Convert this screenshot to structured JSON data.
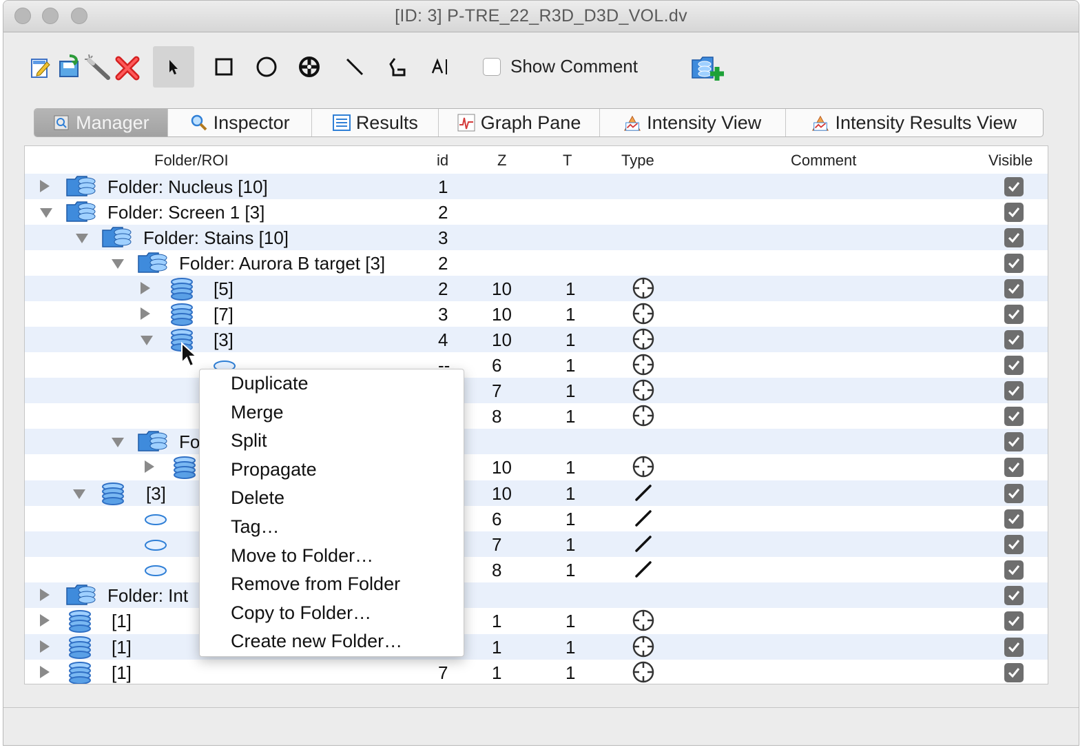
{
  "window": {
    "title": "[ID: 3] P-TRE_22_R3D_D3D_VOL.dv"
  },
  "toolbar": {
    "show_comment_label": "Show Comment",
    "show_comment_checked": false
  },
  "tabs": [
    {
      "label": "Manager",
      "icon": "magnifier-page-icon",
      "selected": true
    },
    {
      "label": "Inspector",
      "icon": "magnifier-icon",
      "selected": false
    },
    {
      "label": "Results",
      "icon": "list-icon",
      "selected": false
    },
    {
      "label": "Graph Pane",
      "icon": "graph-icon",
      "selected": false
    },
    {
      "label": "Intensity View",
      "icon": "intensity-icon",
      "selected": false
    },
    {
      "label": "Intensity Results View",
      "icon": "intensity-icon",
      "selected": false
    }
  ],
  "table": {
    "headers": {
      "folder_roi": "Folder/ROI",
      "id": "id",
      "z": "Z",
      "t": "T",
      "type": "Type",
      "comment": "Comment",
      "visible": "Visible"
    },
    "rows": [
      {
        "label": "Folder: Nucleus [10]",
        "id": "1",
        "z": "",
        "t": "",
        "type": "",
        "disc": "right",
        "icon": "folder"
      },
      {
        "label": "Folder: Screen 1 [3]",
        "id": "2",
        "z": "",
        "t": "",
        "type": "",
        "disc": "down",
        "icon": "folder"
      },
      {
        "label": "Folder: Stains [10]",
        "id": "3",
        "z": "",
        "t": "",
        "type": "",
        "disc": "down",
        "icon": "folder"
      },
      {
        "label": "Folder: Aurora B target [3]",
        "id": "2",
        "z": "",
        "t": "",
        "type": "",
        "disc": "down",
        "icon": "folder"
      },
      {
        "label": "[5]",
        "id": "2",
        "z": "10",
        "t": "1",
        "type": "point",
        "disc": "right",
        "icon": "db"
      },
      {
        "label": "[7]",
        "id": "3",
        "z": "10",
        "t": "1",
        "type": "point",
        "disc": "right",
        "icon": "db"
      },
      {
        "label": "[3]",
        "id": "4",
        "z": "10",
        "t": "1",
        "type": "point",
        "disc": "down",
        "icon": "db"
      },
      {
        "label": "",
        "id": "--",
        "z": "6",
        "t": "1",
        "type": "point",
        "disc": "",
        "icon": "oval"
      },
      {
        "label": "",
        "id": "",
        "z": "7",
        "t": "1",
        "type": "point",
        "disc": "",
        "icon": ""
      },
      {
        "label": "",
        "id": "",
        "z": "8",
        "t": "1",
        "type": "point",
        "disc": "",
        "icon": ""
      },
      {
        "label": "Fo",
        "id": "",
        "z": "",
        "t": "",
        "type": "",
        "disc": "down",
        "icon": "folder"
      },
      {
        "label": "",
        "id": "",
        "z": "10",
        "t": "1",
        "type": "point",
        "disc": "right",
        "icon": "db"
      },
      {
        "label": "[3]",
        "id": "",
        "z": "10",
        "t": "1",
        "type": "line",
        "disc": "down",
        "icon": "db"
      },
      {
        "label": "",
        "id": "",
        "z": "6",
        "t": "1",
        "type": "line",
        "disc": "",
        "icon": "oval"
      },
      {
        "label": "",
        "id": "",
        "z": "7",
        "t": "1",
        "type": "line",
        "disc": "",
        "icon": "oval"
      },
      {
        "label": "",
        "id": "",
        "z": "8",
        "t": "1",
        "type": "line",
        "disc": "",
        "icon": "oval"
      },
      {
        "label": "Folder: Int",
        "id": "",
        "z": "",
        "t": "",
        "type": "",
        "disc": "right",
        "icon": "folder"
      },
      {
        "label": "[1]",
        "id": "",
        "z": "1",
        "t": "1",
        "type": "point",
        "disc": "right",
        "icon": "db"
      },
      {
        "label": "[1]",
        "id": "",
        "z": "1",
        "t": "1",
        "type": "point",
        "disc": "right",
        "icon": "db"
      },
      {
        "label": "[1]",
        "id": "7",
        "z": "1",
        "t": "1",
        "type": "point",
        "disc": "right",
        "icon": "db"
      }
    ]
  },
  "context_menu": {
    "items": [
      "Duplicate",
      "Merge",
      "Split",
      "Propagate",
      "Delete",
      "Tag…",
      "Move to Folder…",
      "Remove from Folder",
      "Copy to Folder…",
      "Create new Folder…"
    ]
  },
  "colors": {
    "accent_blue": "#2f7fd6",
    "row_alt": "#e9f0fb",
    "delete_red": "#e02020"
  }
}
